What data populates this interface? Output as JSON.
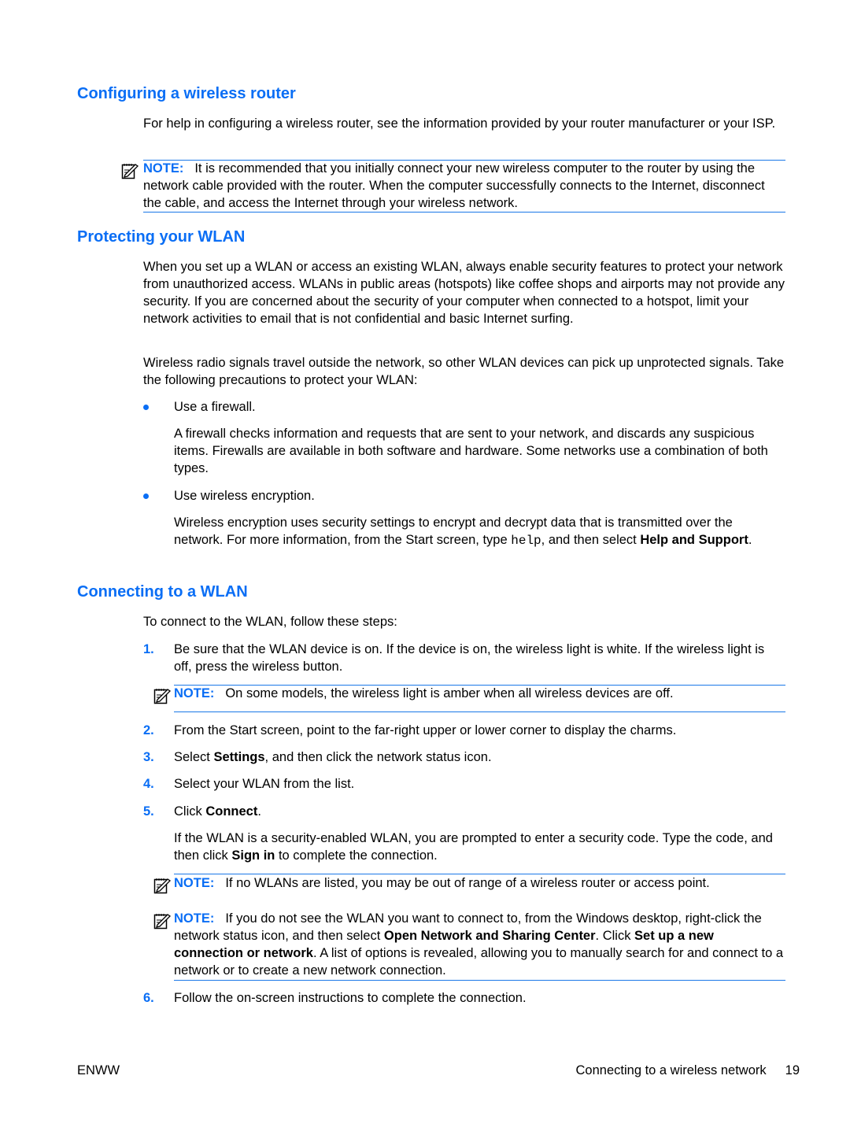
{
  "sections": {
    "configuring": {
      "heading": "Configuring a wireless router",
      "para": "For help in configuring a wireless router, see the information provided by your router manufacturer or your ISP.",
      "note": {
        "label": "NOTE:",
        "text": "It is recommended that you initially connect your new wireless computer to the router by using the network cable provided with the router. When the computer successfully connects to the Internet, disconnect the cable, and access the Internet through your wireless network."
      }
    },
    "protecting": {
      "heading": "Protecting your WLAN",
      "para1": "When you set up a WLAN or access an existing WLAN, always enable security features to protect your network from unauthorized access. WLANs in public areas (hotspots) like coffee shops and airports may not provide any security. If you are concerned about the security of your computer when connected to a hotspot, limit your network activities to email that is not confidential and basic Internet surfing.",
      "para2": "Wireless radio signals travel outside the network, so other WLAN devices can pick up unprotected signals. Take the following precautions to protect your WLAN:",
      "bullets": [
        {
          "title": "Use a firewall.",
          "desc": "A firewall checks information and requests that are sent to your network, and discards any suspicious items. Firewalls are available in both software and hardware. Some networks use a combination of both types."
        },
        {
          "title": "Use wireless encryption.",
          "desc_pre": "Wireless encryption uses security settings to encrypt and decrypt data that is transmitted over the network. For more information, from the Start screen, type ",
          "desc_code": "help",
          "desc_mid": ", and then select ",
          "desc_bold": "Help and Support",
          "desc_post": "."
        }
      ]
    },
    "connecting": {
      "heading": "Connecting to a WLAN",
      "intro": "To connect to the WLAN, follow these steps:",
      "steps": [
        {
          "num": "1.",
          "text": "Be sure that the WLAN device is on. If the device is on, the wireless light is white. If the wireless light is off, press the wireless button."
        },
        {
          "num": "2.",
          "text": "From the Start screen, point to the far-right upper or lower corner to display the charms."
        },
        {
          "num": "3.",
          "pre": "Select ",
          "bold": "Settings",
          "post": ", and then click the network status icon."
        },
        {
          "num": "4.",
          "text": "Select your WLAN from the list."
        },
        {
          "num": "5.",
          "pre": "Click ",
          "bold": "Connect",
          "post": "."
        },
        {
          "num": "6.",
          "text": "Follow the on-screen instructions to complete the connection."
        }
      ],
      "note1": {
        "label": "NOTE:",
        "text": "On some models, the wireless light is amber when all wireless devices are off."
      },
      "step5_detail": {
        "pre": "If the WLAN is a security-enabled WLAN, you are prompted to enter a security code. Type the code, and then click ",
        "bold": "Sign in",
        "post": " to complete the connection."
      },
      "note2": {
        "label": "NOTE:",
        "text": "If no WLANs are listed, you may be out of range of a wireless router or access point."
      },
      "note3": {
        "label": "NOTE:",
        "pre": "If you do not see the WLAN you want to connect to, from the Windows desktop, right-click the network status icon, and then select ",
        "bold1": "Open Network and Sharing Center",
        "mid": ". Click ",
        "bold2": "Set up a new connection or network",
        "post": ". A list of options is revealed, allowing you to manually search for and connect to a network or to create a new network connection."
      }
    }
  },
  "footer": {
    "left": "ENWW",
    "section": "Connecting to a wireless network",
    "page": "19"
  },
  "colors": {
    "accent": "#0a6ef5",
    "rule": "#1a78e8"
  }
}
